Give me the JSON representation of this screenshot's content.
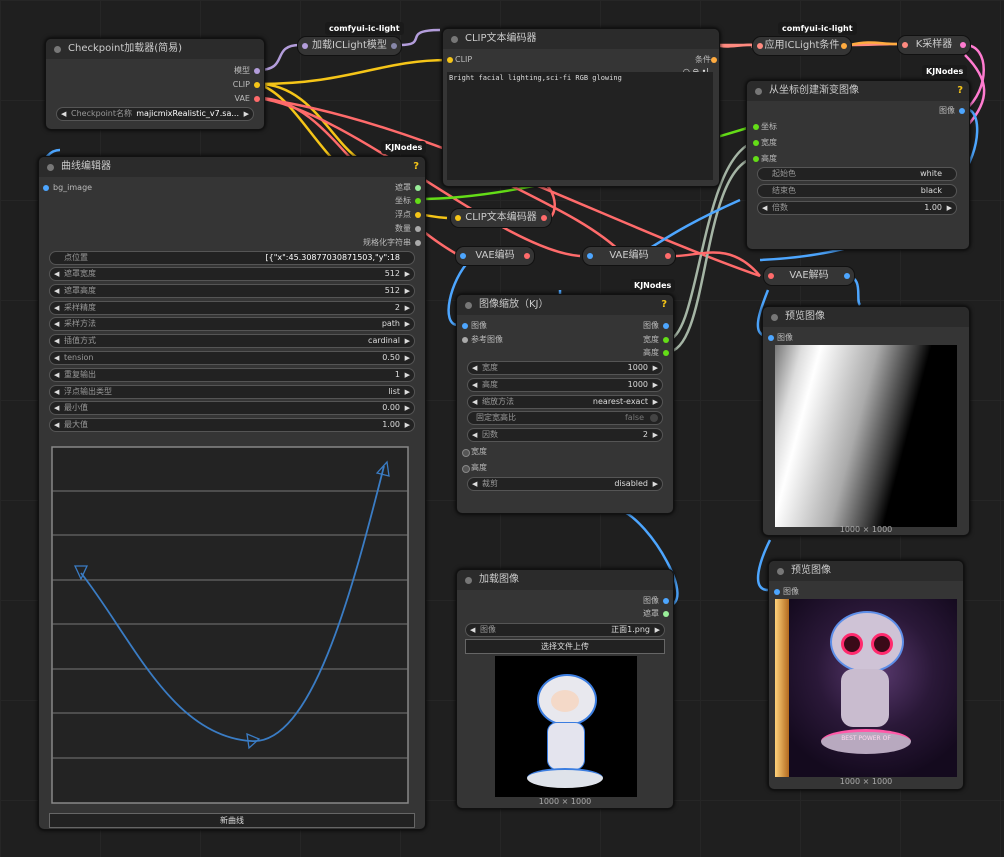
{
  "badges": {
    "ic_light_1": "comfyui-ic-light",
    "ic_light_2": "comfyui-ic-light",
    "kj_1": "KJNodes",
    "kj_2": "KJNodes",
    "kj_3": "KJNodes"
  },
  "checkpoint": {
    "title": "Checkpoint加载器(简易)",
    "out_model": "模型",
    "out_clip": "CLIP",
    "out_vae": "VAE",
    "widget_label": "Checkpoint名称",
    "widget_value": "majicmixRealistic_v7.sa..."
  },
  "load_iclight": {
    "title": "加载ICLight模型"
  },
  "clip_encoder_top": {
    "title": "CLIP文本编码器",
    "in_clip": "CLIP",
    "out_cond": "条件",
    "prompt": "Bright facial lighting,sci-fi RGB glowing"
  },
  "apply_iclight": {
    "title": "应用ICLight条件"
  },
  "ksampler": {
    "title": "K采样器"
  },
  "gradient": {
    "title": "从坐标创建渐变图像",
    "out_image": "图像",
    "in_coords": "坐标",
    "in_width": "宽度",
    "in_height": "高度",
    "widgets": [
      {
        "label": "起始色",
        "value": "white"
      },
      {
        "label": "结束色",
        "value": "black"
      },
      {
        "label": "倍数",
        "value": "1.00"
      }
    ]
  },
  "curve": {
    "title": "曲线编辑器",
    "in_bg": "bg_image",
    "outputs": [
      "遮罩",
      "坐标",
      "浮点",
      "数量",
      "规格化字符串"
    ],
    "points_label": "点位置",
    "points_value": "[{\"x\":45.30877030871503,\"y\":18",
    "widgets": [
      {
        "label": "遮罩宽度",
        "value": "512"
      },
      {
        "label": "遮罩高度",
        "value": "512"
      },
      {
        "label": "采样精度",
        "value": "2"
      },
      {
        "label": "采样方法",
        "value": "path"
      },
      {
        "label": "插值方式",
        "value": "cardinal"
      },
      {
        "label": "tension",
        "value": "0.50"
      },
      {
        "label": "重复输出",
        "value": "1"
      },
      {
        "label": "浮点输出类型",
        "value": "list"
      },
      {
        "label": "最小值",
        "value": "0.00"
      },
      {
        "label": "最大值",
        "value": "1.00"
      }
    ],
    "new_curve": "新曲线"
  },
  "clip_encoder_mid": {
    "title": "CLIP文本编码器"
  },
  "vae_encode_1": {
    "title": "VAE编码"
  },
  "vae_encode_2": {
    "title": "VAE编码"
  },
  "vae_decode": {
    "title": "VAE解码"
  },
  "resize": {
    "title": "图像缩放（KJ）",
    "in_image": "图像",
    "in_ref": "参考图像",
    "outputs": [
      "图像",
      "宽度",
      "高度"
    ],
    "widgets": [
      {
        "label": "宽度",
        "value": "1000"
      },
      {
        "label": "高度",
        "value": "1000"
      },
      {
        "label": "缩放方法",
        "value": "nearest-exact"
      },
      {
        "label": "固定宽高比",
        "value": "false"
      },
      {
        "label": "因数",
        "value": "2"
      }
    ],
    "extra_in": [
      "宽度",
      "高度"
    ],
    "crop_label": "裁剪",
    "crop_value": "disabled"
  },
  "preview1": {
    "title": "预览图像",
    "in_image": "图像",
    "size": "1000 × 1000"
  },
  "preview2": {
    "title": "预览图像",
    "in_image": "图像",
    "size": "1000 × 1000",
    "banner": "BEST POWER OF"
  },
  "load_image": {
    "title": "加载图像",
    "outputs": [
      "图像",
      "遮罩"
    ],
    "widget_label": "图像",
    "widget_value": "正面1.png",
    "upload": "选择文件上传",
    "size": "1000 × 1000"
  }
}
